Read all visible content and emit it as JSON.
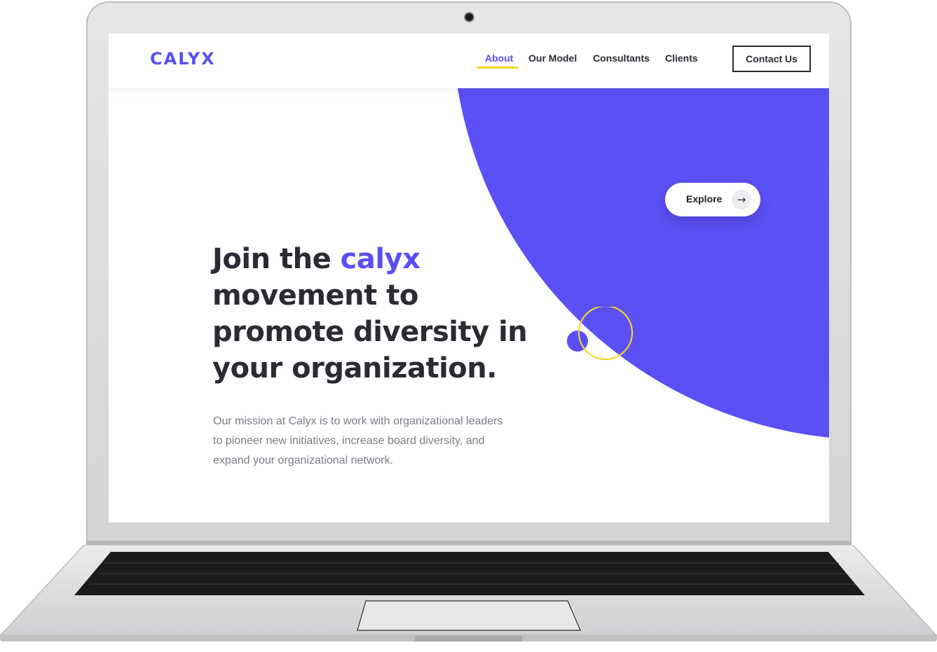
{
  "site": {
    "logo": "CALYX",
    "nav": {
      "items": [
        {
          "label": "About",
          "active": true
        },
        {
          "label": "Our Model",
          "active": false
        },
        {
          "label": "Consultants",
          "active": false
        },
        {
          "label": "Clients",
          "active": false
        }
      ],
      "cta_label": "Contact Us"
    },
    "hero": {
      "headline_line1_prefix": "Join the ",
      "headline_highlight": "calyx",
      "headline_rest_line2": "movement to",
      "headline_rest_line3": "promote diversity in",
      "headline_rest_line4": "your organization.",
      "mission_text": "Our mission at Calyx is to work with organizational leaders to pioneer new initiatives, increase board diversity, and expand your organizational network.",
      "explore_label": "Explore",
      "explore_icon": "arrow-right-icon"
    }
  },
  "colors": {
    "brand": "#5a4ff5",
    "brand_gradient_light": "#2a86ff",
    "accent_yellow": "#f1d72a",
    "text_dark": "#2b2b33",
    "text_muted": "#7b7b85"
  }
}
